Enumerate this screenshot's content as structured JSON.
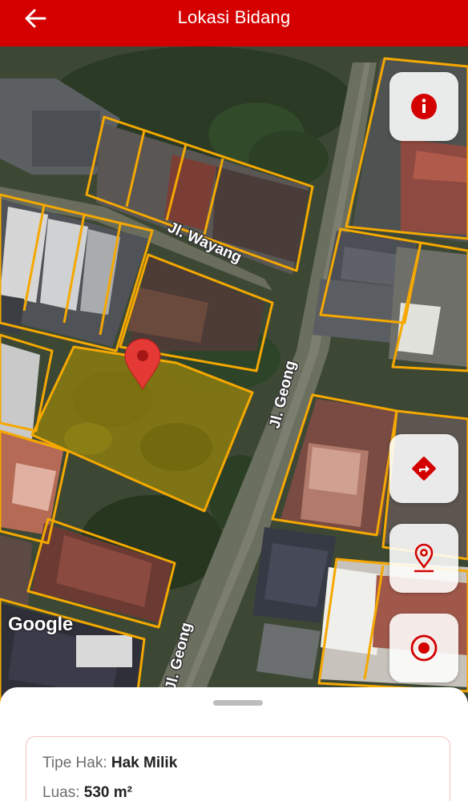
{
  "header": {
    "title": "Lokasi Bidang",
    "back_icon": "arrow-left-icon"
  },
  "map": {
    "street_labels": {
      "wayang": "Jl. Wayang",
      "geong_top": "Jl. Geong",
      "geong_bottom": "Jl. Geong"
    },
    "attribution": "Google",
    "marker_color": "#e53935",
    "parcel_outline_color": "#f5a800",
    "selected_parcel_fill": "#8a7d10"
  },
  "map_controls": {
    "info": "info-icon",
    "directions": "directions-icon",
    "location_pin": "location-pin-icon",
    "my_location": "target-icon",
    "accent": "#d40000"
  },
  "sheet": {
    "rights_type_label": "Tipe Hak:",
    "rights_type_value": "Hak Milik",
    "area_label": "Luas:",
    "area_value": "530 m²"
  }
}
